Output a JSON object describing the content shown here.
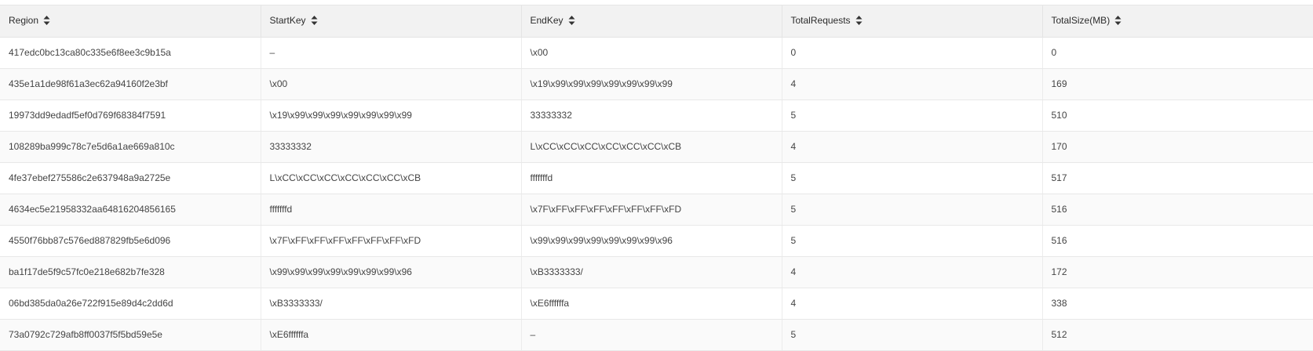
{
  "table": {
    "columns": [
      {
        "label": "Region",
        "sort_icon": "sort-icon"
      },
      {
        "label": "StartKey",
        "sort_icon": "sort-icon"
      },
      {
        "label": "EndKey",
        "sort_icon": "sort-icon"
      },
      {
        "label": "TotalRequests",
        "sort_icon": "sort-icon"
      },
      {
        "label": "TotalSize(MB)",
        "sort_icon": "sort-icon"
      }
    ],
    "rows": [
      [
        "417edc0bc13ca80c335e6f8ee3c9b15a",
        "–",
        "\\x00",
        "0",
        "0"
      ],
      [
        "435e1a1de98f61a3ec62a94160f2e3bf",
        "\\x00",
        "\\x19\\x99\\x99\\x99\\x99\\x99\\x99\\x99",
        "4",
        "169"
      ],
      [
        "19973dd9edadf5ef0d769f68384f7591",
        "\\x19\\x99\\x99\\x99\\x99\\x99\\x99\\x99",
        "33333332",
        "5",
        "510"
      ],
      [
        "108289ba999c78c7e5d6a1ae669a810c",
        "33333332",
        "L\\xCC\\xCC\\xCC\\xCC\\xCC\\xCC\\xCB",
        "4",
        "170"
      ],
      [
        "4fe37ebef275586c2e637948a9a2725e",
        "L\\xCC\\xCC\\xCC\\xCC\\xCC\\xCC\\xCB",
        "fffffffd",
        "5",
        "517"
      ],
      [
        "4634ec5e21958332aa64816204856165",
        "fffffffd",
        "\\x7F\\xFF\\xFF\\xFF\\xFF\\xFF\\xFF\\xFD",
        "5",
        "516"
      ],
      [
        "4550f76bb87c576ed887829fb5e6d096",
        "\\x7F\\xFF\\xFF\\xFF\\xFF\\xFF\\xFF\\xFD",
        "\\x99\\x99\\x99\\x99\\x99\\x99\\x99\\x96",
        "5",
        "516"
      ],
      [
        "ba1f17de5f9c57fc0e218e682b7fe328",
        "\\x99\\x99\\x99\\x99\\x99\\x99\\x99\\x96",
        "\\xB3333333/",
        "4",
        "172"
      ],
      [
        "06bd385da0a26e722f915e89d4c2dd6d",
        "\\xB3333333/",
        "\\xE6ffffffa",
        "4",
        "338"
      ],
      [
        "73a0792c729afb8ff0037f5f5bd59e5e",
        "\\xE6ffffffa",
        "–",
        "5",
        "512"
      ]
    ]
  },
  "colors": {
    "header_bg": "#f2f2f2",
    "row_alt_bg": "#fafafa",
    "text": "#444444",
    "sort_icon": "#333333"
  }
}
